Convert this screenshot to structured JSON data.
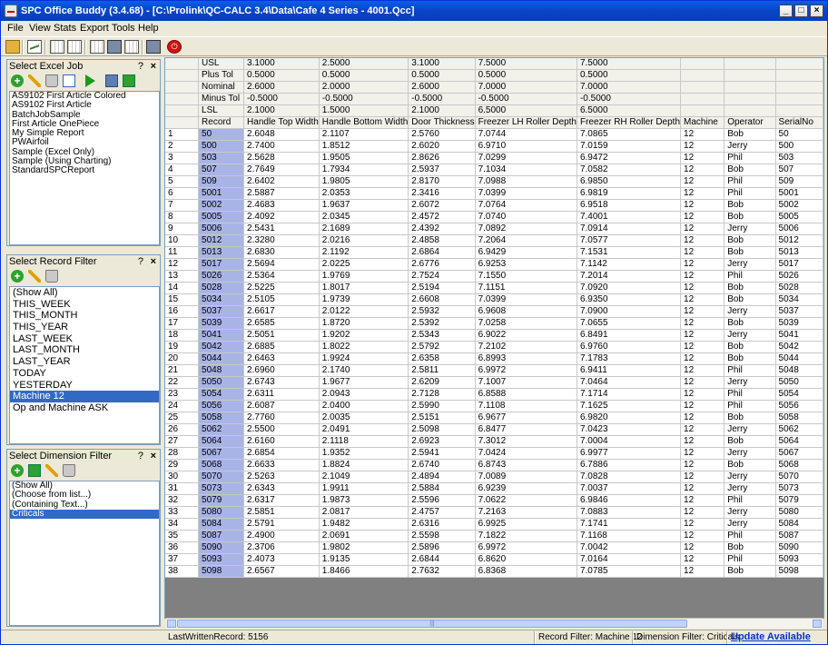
{
  "window": {
    "title": "SPC Office Buddy (3.4.68) - [C:\\Prolink\\QC-CALC 3.4\\Data\\Cafe 4 Series - 4001.Qcc]",
    "controls": [
      "_",
      "□",
      "×"
    ]
  },
  "menu": [
    "File",
    "View",
    "Stats",
    "Export",
    "Tools",
    "Help"
  ],
  "toolbar_icons": [
    "open-folder-icon",
    "chart-icon",
    "grid-icon",
    "grid-refresh-icon",
    "table-icon",
    "tools-icon",
    "grid-add-icon",
    "wrench-icon",
    "stop-icon"
  ],
  "excel_job": {
    "title": "Select Excel Job",
    "help": "?",
    "close": "×",
    "items": [
      "AS9102 First Article Colored",
      "AS9102 First Article",
      "BatchJobSample",
      "First Article OnePiece",
      "My Simple Report",
      "PWAirfoil",
      "Sample (Excel Only)",
      "Sample (Using Charting)",
      "StandardSPCReport"
    ]
  },
  "record_filter": {
    "title": "Select Record Filter",
    "help": "?",
    "close": "×",
    "items": [
      "(Show All)",
      "THIS_WEEK",
      "THIS_MONTH",
      "THIS_YEAR",
      "LAST_WEEK",
      "LAST_MONTH",
      "LAST_YEAR",
      "TODAY",
      "YESTERDAY",
      "Machine 12",
      "Op and Machine ASK"
    ],
    "selected": "Machine 12"
  },
  "dimension_filter": {
    "title": "Select Dimension Filter",
    "help": "?",
    "close": "×",
    "items": [
      "(Show All)",
      "(Choose from list...)",
      "(Containing Text...)",
      "Criticals"
    ],
    "selected": "Criticals"
  },
  "grid": {
    "spec_rows": [
      {
        "label": "USL",
        "values": [
          "3.1000",
          "2.5000",
          "3.1000",
          "7.5000",
          "7.5000"
        ]
      },
      {
        "label": "Plus Tol",
        "values": [
          "0.5000",
          "0.5000",
          "0.5000",
          "0.5000",
          "0.5000"
        ]
      },
      {
        "label": "Nominal",
        "values": [
          "2.6000",
          "2.0000",
          "2.6000",
          "7.0000",
          "7.0000"
        ]
      },
      {
        "label": "Minus Tol",
        "values": [
          "-0.5000",
          "-0.5000",
          "-0.5000",
          "-0.5000",
          "-0.5000"
        ]
      },
      {
        "label": "LSL",
        "values": [
          "2.1000",
          "1.5000",
          "2.1000",
          "6.5000",
          "6.5000"
        ]
      }
    ],
    "columns": [
      "Record",
      "Handle Top Width",
      "Handle Bottom Width",
      "Door Thickness",
      "Freezer LH Roller Depth",
      "Freezer RH Roller Depth",
      "Machine",
      "Operator",
      "SerialNo"
    ],
    "rows": [
      [
        "1",
        "50",
        "2.6048",
        "2.1107",
        "2.5760",
        "7.0744",
        "7.0865",
        "12",
        "Bob",
        "50"
      ],
      [
        "2",
        "500",
        "2.7400",
        "1.8512",
        "2.6020",
        "6.9710",
        "7.0159",
        "12",
        "Jerry",
        "500"
      ],
      [
        "3",
        "503",
        "2.5628",
        "1.9505",
        "2.8626",
        "7.0299",
        "6.9472",
        "12",
        "Phil",
        "503"
      ],
      [
        "4",
        "507",
        "2.7649",
        "1.7934",
        "2.5937",
        "7.1034",
        "7.0582",
        "12",
        "Bob",
        "507"
      ],
      [
        "5",
        "509",
        "2.6402",
        "1.9805",
        "2.8170",
        "7.0988",
        "6.9850",
        "12",
        "Phil",
        "509"
      ],
      [
        "6",
        "5001",
        "2.5887",
        "2.0353",
        "2.3416",
        "7.0399",
        "6.9819",
        "12",
        "Phil",
        "5001"
      ],
      [
        "7",
        "5002",
        "2.4683",
        "1.9637",
        "2.6072",
        "7.0764",
        "6.9518",
        "12",
        "Bob",
        "5002"
      ],
      [
        "8",
        "5005",
        "2.4092",
        "2.0345",
        "2.4572",
        "7.0740",
        "7.4001",
        "12",
        "Bob",
        "5005"
      ],
      [
        "9",
        "5006",
        "2.5431",
        "2.1689",
        "2.4392",
        "7.0892",
        "7.0914",
        "12",
        "Jerry",
        "5006"
      ],
      [
        "10",
        "5012",
        "2.3280",
        "2.0216",
        "2.4858",
        "7.2064",
        "7.0577",
        "12",
        "Bob",
        "5012"
      ],
      [
        "11",
        "5013",
        "2.6830",
        "2.1192",
        "2.6864",
        "6.9429",
        "7.1531",
        "12",
        "Bob",
        "5013"
      ],
      [
        "12",
        "5017",
        "2.5694",
        "2.0225",
        "2.6776",
        "6.9253",
        "7.1142",
        "12",
        "Jerry",
        "5017"
      ],
      [
        "13",
        "5026",
        "2.5364",
        "1.9769",
        "2.7524",
        "7.1550",
        "7.2014",
        "12",
        "Phil",
        "5026"
      ],
      [
        "14",
        "5028",
        "2.5225",
        "1.8017",
        "2.5194",
        "7.1151",
        "7.0920",
        "12",
        "Bob",
        "5028"
      ],
      [
        "15",
        "5034",
        "2.5105",
        "1.9739",
        "2.6608",
        "7.0399",
        "6.9350",
        "12",
        "Bob",
        "5034"
      ],
      [
        "16",
        "5037",
        "2.6617",
        "2.0122",
        "2.5932",
        "6.9608",
        "7.0900",
        "12",
        "Jerry",
        "5037"
      ],
      [
        "17",
        "5039",
        "2.6585",
        "1.8720",
        "2.5392",
        "7.0258",
        "7.0655",
        "12",
        "Bob",
        "5039"
      ],
      [
        "18",
        "5041",
        "2.5051",
        "1.9202",
        "2.5343",
        "6.9022",
        "6.8491",
        "12",
        "Jerry",
        "5041"
      ],
      [
        "19",
        "5042",
        "2.6885",
        "1.8022",
        "2.5792",
        "7.2102",
        "6.9760",
        "12",
        "Bob",
        "5042"
      ],
      [
        "20",
        "5044",
        "2.6463",
        "1.9924",
        "2.6358",
        "6.8993",
        "7.1783",
        "12",
        "Bob",
        "5044"
      ],
      [
        "21",
        "5048",
        "2.6960",
        "2.1740",
        "2.5811",
        "6.9972",
        "6.9411",
        "12",
        "Phil",
        "5048"
      ],
      [
        "22",
        "5050",
        "2.6743",
        "1.9677",
        "2.6209",
        "7.1007",
        "7.0464",
        "12",
        "Jerry",
        "5050"
      ],
      [
        "23",
        "5054",
        "2.6311",
        "2.0943",
        "2.7128",
        "6.8588",
        "7.1714",
        "12",
        "Phil",
        "5054"
      ],
      [
        "24",
        "5056",
        "2.6087",
        "2.0400",
        "2.5990",
        "7.1108",
        "7.1625",
        "12",
        "Phil",
        "5056"
      ],
      [
        "25",
        "5058",
        "2.7760",
        "2.0035",
        "2.5151",
        "6.9677",
        "6.9820",
        "12",
        "Bob",
        "5058"
      ],
      [
        "26",
        "5062",
        "2.5500",
        "2.0491",
        "2.5098",
        "6.8477",
        "7.0423",
        "12",
        "Jerry",
        "5062"
      ],
      [
        "27",
        "5064",
        "2.6160",
        "2.1118",
        "2.6923",
        "7.3012",
        "7.0004",
        "12",
        "Bob",
        "5064"
      ],
      [
        "28",
        "5067",
        "2.6854",
        "1.9352",
        "2.5941",
        "7.0424",
        "6.9977",
        "12",
        "Jerry",
        "5067"
      ],
      [
        "29",
        "5068",
        "2.6633",
        "1.8824",
        "2.6740",
        "6.8743",
        "6.7886",
        "12",
        "Bob",
        "5068"
      ],
      [
        "30",
        "5070",
        "2.5263",
        "2.1049",
        "2.4894",
        "7.0089",
        "7.0828",
        "12",
        "Jerry",
        "5070"
      ],
      [
        "31",
        "5073",
        "2.6343",
        "1.9911",
        "2.5884",
        "6.9239",
        "7.0037",
        "12",
        "Jerry",
        "5073"
      ],
      [
        "32",
        "5079",
        "2.6317",
        "1.9873",
        "2.5596",
        "7.0622",
        "6.9846",
        "12",
        "Phil",
        "5079"
      ],
      [
        "33",
        "5080",
        "2.5851",
        "2.0817",
        "2.4757",
        "7.2163",
        "7.0883",
        "12",
        "Jerry",
        "5080"
      ],
      [
        "34",
        "5084",
        "2.5791",
        "1.9482",
        "2.6316",
        "6.9925",
        "7.1741",
        "12",
        "Jerry",
        "5084"
      ],
      [
        "35",
        "5087",
        "2.4900",
        "2.0691",
        "2.5598",
        "7.1822",
        "7.1168",
        "12",
        "Phil",
        "5087"
      ],
      [
        "36",
        "5090",
        "2.3706",
        "1.9802",
        "2.5896",
        "6.9972",
        "7.0042",
        "12",
        "Bob",
        "5090"
      ],
      [
        "37",
        "5093",
        "2.4073",
        "1.9135",
        "2.6844",
        "6.8620",
        "7.0164",
        "12",
        "Phil",
        "5093"
      ],
      [
        "38",
        "5098",
        "2.6567",
        "1.8466",
        "2.7632",
        "6.8368",
        "7.0785",
        "12",
        "Bob",
        "5098"
      ]
    ]
  },
  "status": {
    "last_written": "LastWrittenRecord: 5156",
    "record_filter": "Record Filter: Machine 12",
    "dimension_filter": "Dimension Filter: Criticals",
    "update": "Update Available"
  }
}
